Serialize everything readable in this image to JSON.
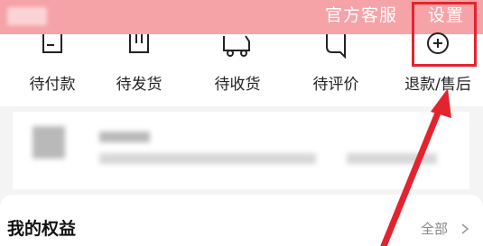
{
  "header": {
    "customer_service": "官方客服",
    "settings": "设置"
  },
  "orders": [
    {
      "label": "待付款",
      "icon": "wallet-icon"
    },
    {
      "label": "待发货",
      "icon": "package-icon"
    },
    {
      "label": "待收货",
      "icon": "truck-icon"
    },
    {
      "label": "待评价",
      "icon": "comment-icon"
    },
    {
      "label": "退款/售后",
      "icon": "refund-icon"
    }
  ],
  "rights": {
    "title": "我的权益",
    "view_all": "全部"
  },
  "annotation": {
    "color": "#e3242e",
    "target": "设置"
  },
  "colors": {
    "header_bg": "#f6a3a8",
    "accent": "#e3242e"
  }
}
